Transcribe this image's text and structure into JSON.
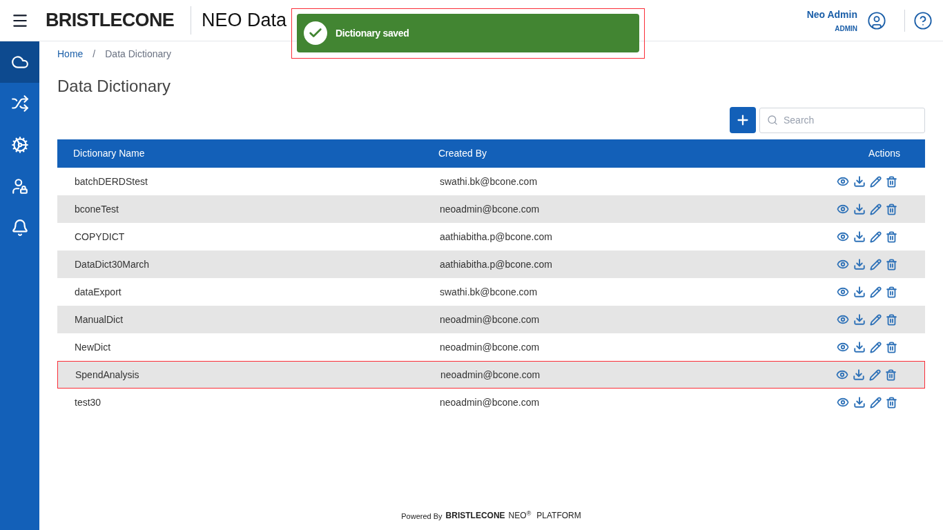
{
  "header": {
    "logo": "BRISTLECONE",
    "app_title": "NEO Data",
    "user_name": "Neo Admin",
    "user_role": "ADMIN"
  },
  "toast": {
    "message": "Dictionary saved",
    "highlighted": true
  },
  "sidebar": {
    "items": [
      {
        "selected": true
      },
      {
        "selected": false
      },
      {
        "selected": false
      },
      {
        "selected": false
      },
      {
        "selected": false
      }
    ]
  },
  "breadcrumb": {
    "items": [
      "Home",
      "Data Dictionary"
    ],
    "separator": "/"
  },
  "page_title": "Data Dictionary",
  "search": {
    "placeholder": "Search"
  },
  "table": {
    "columns": [
      "Dictionary Name",
      "Created By",
      "Actions"
    ],
    "rows": [
      {
        "name": "batchDERDStest",
        "created_by": "swathi.bk@bcone.com",
        "highlighted": false
      },
      {
        "name": "bconeTest",
        "created_by": "neoadmin@bcone.com",
        "highlighted": false
      },
      {
        "name": "COPYDICT",
        "created_by": "aathiabitha.p@bcone.com",
        "highlighted": false
      },
      {
        "name": "DataDict30March",
        "created_by": "aathiabitha.p@bcone.com",
        "highlighted": false
      },
      {
        "name": "dataExport",
        "created_by": "swathi.bk@bcone.com",
        "highlighted": false
      },
      {
        "name": "ManualDict",
        "created_by": "neoadmin@bcone.com",
        "highlighted": false
      },
      {
        "name": "NewDict",
        "created_by": "neoadmin@bcone.com",
        "highlighted": false
      },
      {
        "name": "SpendAnalysis",
        "created_by": "neoadmin@bcone.com",
        "highlighted": true
      },
      {
        "name": "test30",
        "created_by": "neoadmin@bcone.com",
        "highlighted": false
      }
    ]
  },
  "footer": {
    "powered_by": "Powered By",
    "brand": "BRISTLECONE",
    "product": "NEO$^{®}$",
    "platform": "PLATFORM"
  }
}
